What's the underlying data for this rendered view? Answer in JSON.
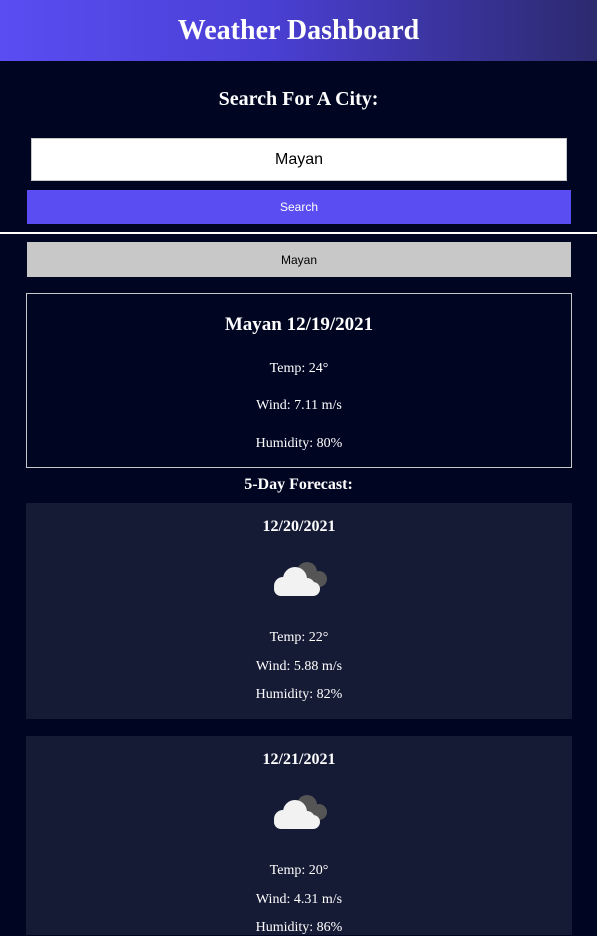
{
  "header": {
    "title": "Weather Dashboard"
  },
  "search": {
    "heading": "Search For A City:",
    "value": "Mayan",
    "button_label": "Search"
  },
  "history": [
    {
      "label": "Mayan"
    }
  ],
  "current": {
    "title": "Mayan 12/19/2021",
    "temp": "Temp: 24°",
    "wind": "Wind: 7.11 m/s",
    "humidity": "Humidity: 80%"
  },
  "forecast": {
    "heading": "5-Day Forecast:",
    "days": [
      {
        "date": "12/20/2021",
        "icon": "cloudy-icon",
        "temp": "Temp: 22°",
        "wind": "Wind: 5.88 m/s",
        "humidity": "Humidity: 82%"
      },
      {
        "date": "12/21/2021",
        "icon": "cloudy-icon",
        "temp": "Temp: 20°",
        "wind": "Wind: 4.31 m/s",
        "humidity": "Humidity: 86%"
      }
    ]
  },
  "colors": {
    "background": "#000522",
    "accent": "#5a4df2",
    "card": "#151a35",
    "history_button": "#c8c8c8"
  }
}
